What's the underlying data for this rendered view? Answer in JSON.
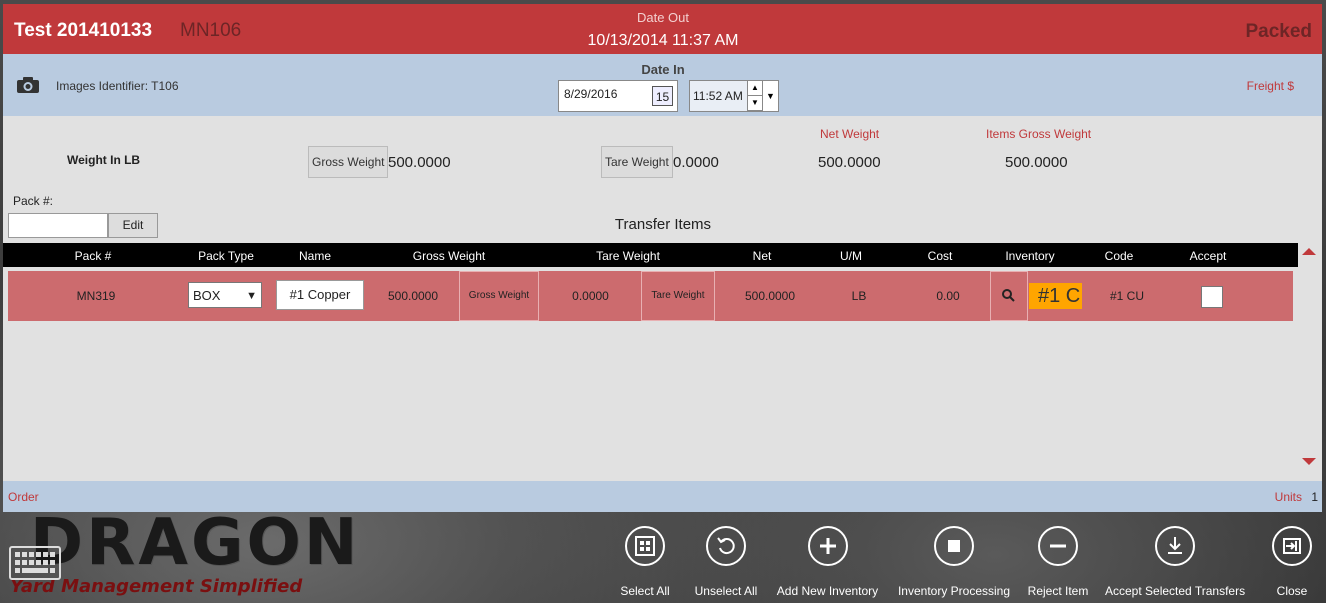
{
  "header": {
    "title": "Test 201410133",
    "subtitle": "MN106",
    "date_out_label": "Date Out",
    "date_out_value": "10/13/2014 11:37 AM",
    "status": "Packed"
  },
  "info_bar": {
    "images_identifier": "Images Identifier: T106",
    "date_in_label": "Date In",
    "date_in_value": "8/29/2016",
    "calendar_day": "15",
    "time_value": "11:52 AM",
    "freight_label": "Freight $"
  },
  "weights": {
    "unit_label": "Weight In LB",
    "gross_label": "Gross Weight",
    "gross_value": "500.0000",
    "tare_label": "Tare Weight",
    "tare_value": "0.0000",
    "net_label": "Net Weight",
    "net_value": "500.0000",
    "items_gross_label": "Items Gross Weight",
    "items_gross_value": "500.0000"
  },
  "pack": {
    "label": "Pack #:",
    "input_value": "",
    "edit_label": "Edit"
  },
  "transfer_title": "Transfer Items",
  "table": {
    "columns": [
      "Pack #",
      "Pack Type",
      "Name",
      "Gross Weight",
      "Tare Weight",
      "Net",
      "U/M",
      "Cost",
      "Inventory",
      "Code",
      "Accept"
    ],
    "rows": [
      {
        "pack": "MN319",
        "pack_type": "BOX",
        "name": "#1 Copper",
        "gross": "500.0000",
        "gross_btn": "Gross Weight",
        "tare": "0.0000",
        "tare_btn": "Tare Weight",
        "net": "500.0000",
        "um": "LB",
        "cost": "0.00",
        "inventory_tag": "#1 C",
        "code": "#1 CU"
      }
    ]
  },
  "footer": {
    "order_label": "Order",
    "units_label": "Units",
    "units_value": "1"
  },
  "branding": {
    "logo": "DRAGON",
    "tagline": "Yard Management Simplified"
  },
  "actions": [
    {
      "label": "Select All",
      "icon": "select-all-icon"
    },
    {
      "label": "Unselect All",
      "icon": "undo-icon"
    },
    {
      "label": "Add New Inventory",
      "icon": "plus-icon"
    },
    {
      "label": "Inventory Processing",
      "icon": "stop-icon"
    },
    {
      "label": "Reject Item",
      "icon": "minus-icon"
    },
    {
      "label": "Accept Selected Transfers",
      "icon": "download-icon"
    },
    {
      "label": "Close",
      "icon": "exit-icon"
    }
  ],
  "colors": {
    "header_red": "#c0393b",
    "info_blue": "#b9cbe0",
    "row_red": "#cc6b6e",
    "inventory_orange": "#ffa500"
  }
}
